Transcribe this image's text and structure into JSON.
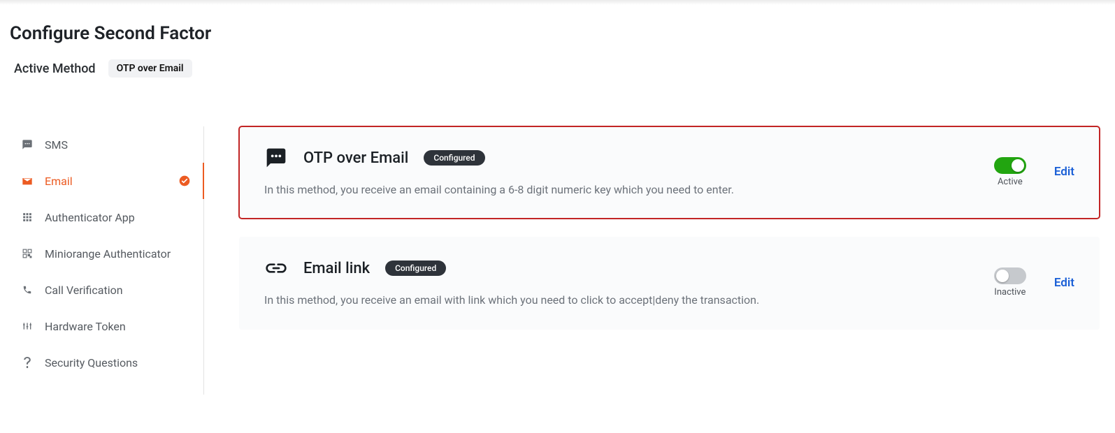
{
  "page": {
    "title": "Configure Second Factor"
  },
  "active_method": {
    "label": "Active Method",
    "value": "OTP over Email"
  },
  "sidebar": {
    "items": [
      {
        "label": "SMS",
        "selected": false
      },
      {
        "label": "Email",
        "selected": true
      },
      {
        "label": "Authenticator App",
        "selected": false
      },
      {
        "label": "Miniorange Authenticator",
        "selected": false
      },
      {
        "label": "Call Verification",
        "selected": false
      },
      {
        "label": "Hardware Token",
        "selected": false
      },
      {
        "label": "Security Questions",
        "selected": false
      }
    ]
  },
  "methods": [
    {
      "title": "OTP over Email",
      "status": "Configured",
      "description": "In this method, you receive an email containing a 6-8 digit numeric key which you need to enter.",
      "toggle_state": "Active",
      "toggle_on": true,
      "edit_label": "Edit",
      "highlighted": true
    },
    {
      "title": "Email link",
      "status": "Configured",
      "description": "In this method, you receive an email with link which you need to click to accept|deny the transaction.",
      "toggle_state": "Inactive",
      "toggle_on": false,
      "edit_label": "Edit",
      "highlighted": false
    }
  ]
}
